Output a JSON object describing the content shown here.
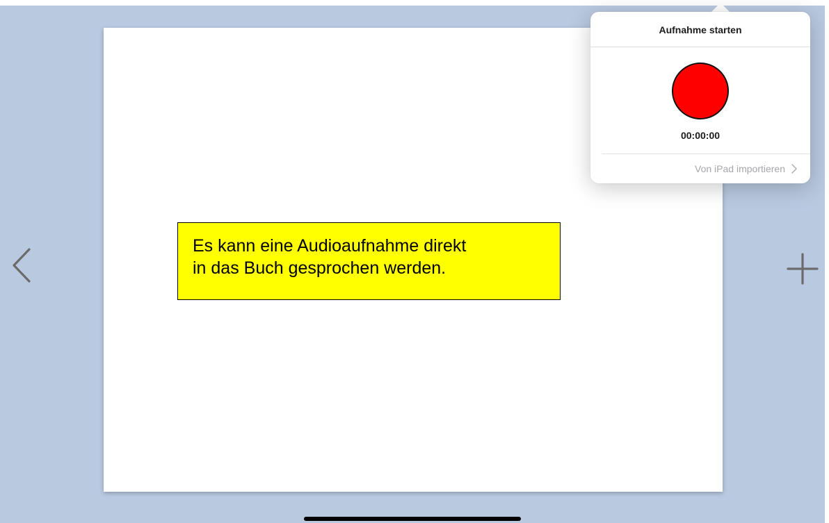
{
  "navigation": {
    "back_icon": "chevron-left-icon",
    "add_icon": "plus-icon"
  },
  "callout": {
    "line1": "Es kann eine Audioaufnahme direkt",
    "line2": "in das Buch gesprochen werden.",
    "background": "#ffff00"
  },
  "popover": {
    "title": "Aufnahme starten",
    "record_icon": "record-icon",
    "record_color": "#fe0000",
    "timer": "00:00:00",
    "import_label": "Von iPad importieren",
    "import_icon": "chevron-right-icon"
  },
  "colors": {
    "background": "#b9c9e0",
    "page": "#ffffff"
  }
}
